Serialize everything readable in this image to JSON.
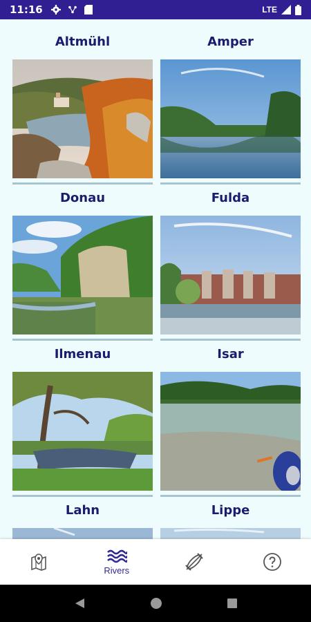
{
  "status_bar": {
    "time": "11:16",
    "network": "LTE"
  },
  "rivers": [
    {
      "name": "Altmühl"
    },
    {
      "name": "Amper"
    },
    {
      "name": "Donau"
    },
    {
      "name": "Fulda"
    },
    {
      "name": "Ilmenau"
    },
    {
      "name": "Isar"
    },
    {
      "name": "Lahn"
    },
    {
      "name": "Lippe"
    }
  ],
  "bottom_nav": {
    "items": [
      {
        "icon": "map-pin-icon",
        "label": ""
      },
      {
        "icon": "waves-icon",
        "label": "Rivers"
      },
      {
        "icon": "kayak-icon",
        "label": ""
      },
      {
        "icon": "help-icon",
        "label": ""
      }
    ],
    "active_color": "#2f2a93"
  },
  "colors": {
    "status_bar": "#2f1f93",
    "background": "#eefcfd",
    "title": "#1b1c6e"
  }
}
